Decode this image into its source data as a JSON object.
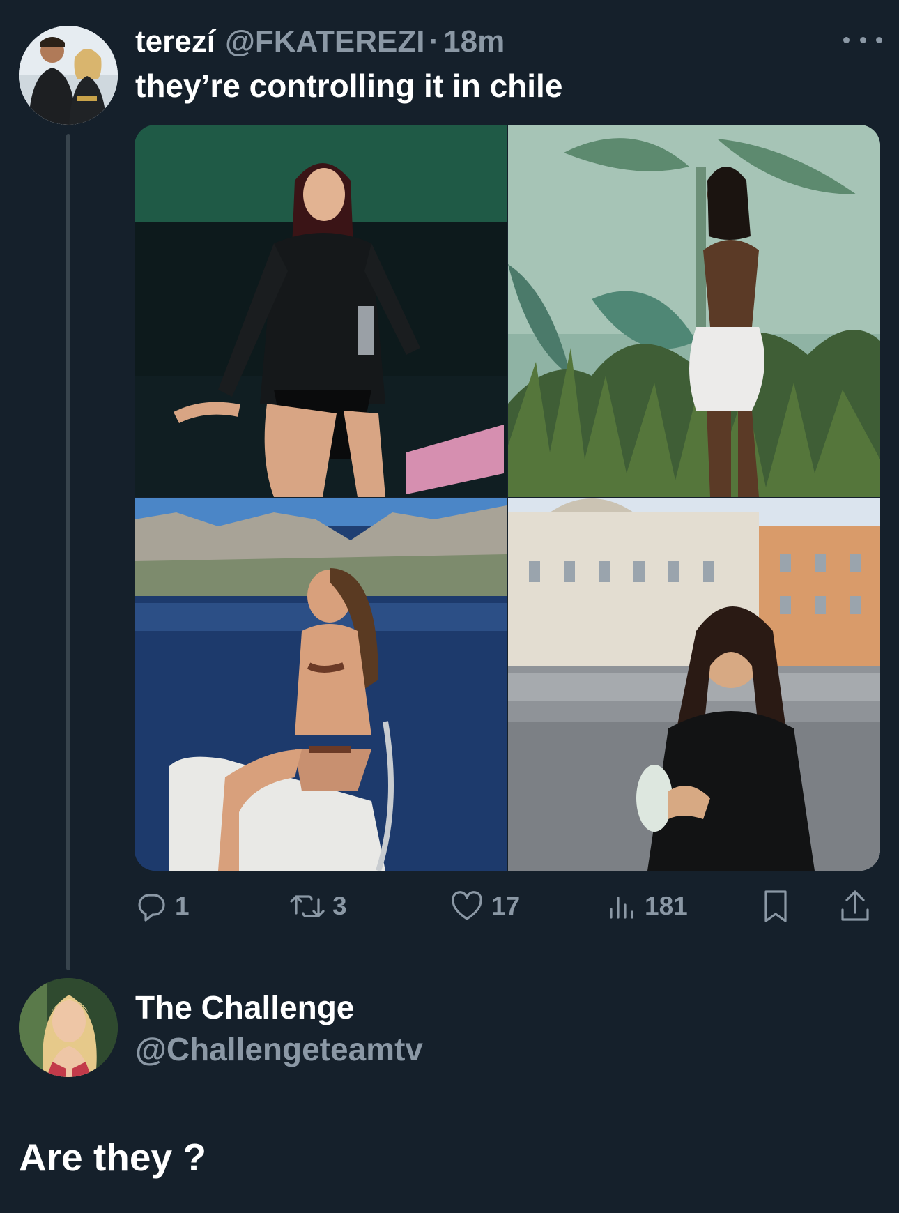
{
  "tweet": {
    "display_name": "terezí",
    "handle": "@FKATEREZI",
    "separator": "·",
    "time": "18m",
    "text": "they’re controlling it in chile",
    "photos": [
      "photo-woman-dark-outfit-green-room",
      "photo-woman-white-dress-jungle-mural",
      "photo-woman-bikini-on-boat",
      "photo-woman-with-drink-city-square"
    ],
    "stats": {
      "replies": "1",
      "retweets": "3",
      "likes": "17",
      "views": "181"
    },
    "icons": {
      "reply": "reply-icon",
      "retweet": "retweet-icon",
      "like": "heart-icon",
      "views": "views-icon",
      "bookmark": "bookmark-icon",
      "share": "share-icon",
      "more": "more-icon"
    }
  },
  "reply": {
    "display_name": "The Challenge",
    "handle": "@Challengeteamtv",
    "text": "Are they ?"
  },
  "colors": {
    "background": "#15202b",
    "primary_text": "#ffffff",
    "secondary_text": "#8b98a5",
    "thread_line": "#38444d"
  }
}
